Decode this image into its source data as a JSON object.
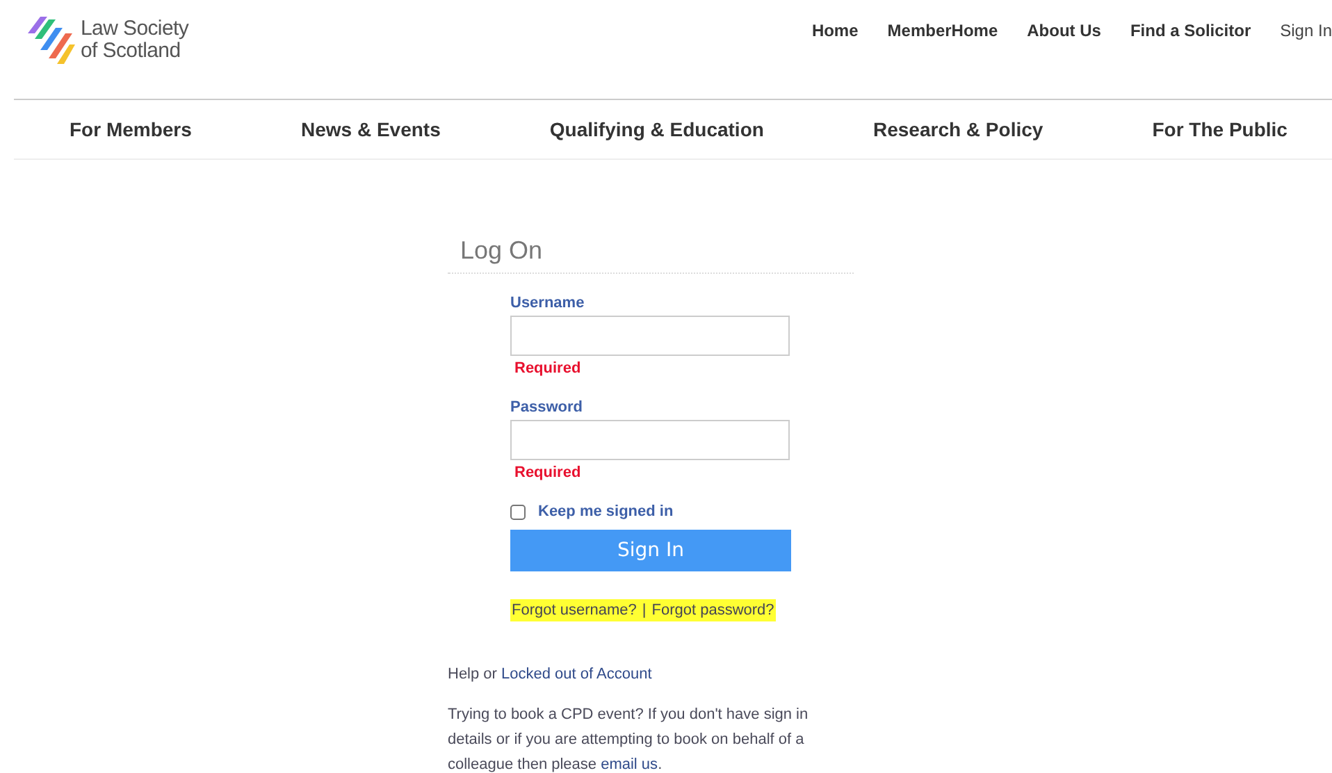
{
  "logo": {
    "line1": "Law Society",
    "line2": "of Scotland"
  },
  "top_links": [
    "Home",
    "MemberHome",
    "About Us",
    "Find a Solicitor",
    "Sign In"
  ],
  "nav": [
    "For Members",
    "News & Events",
    "Qualifying & Education",
    "Research & Policy",
    "For The Public"
  ],
  "form": {
    "title": "Log On",
    "fields": [
      {
        "label": "Username",
        "error": "Required"
      },
      {
        "label": "Password",
        "error": "Required"
      }
    ],
    "remember": {
      "label": "Keep me signed in",
      "checked": false
    },
    "submit": "Sign In",
    "recovery": {
      "highlighted": true,
      "links": [
        "Forgot username?",
        "Forgot password?"
      ],
      "separator": "|"
    }
  },
  "help": {
    "prefix": "Help or",
    "link": "Locked out of Account"
  },
  "cpd": {
    "text": "Trying to book a CPD event? If you don't have sign in details or if you are attempting to book on behalf of a colleague then please",
    "link": "email us",
    "suffix": "."
  }
}
